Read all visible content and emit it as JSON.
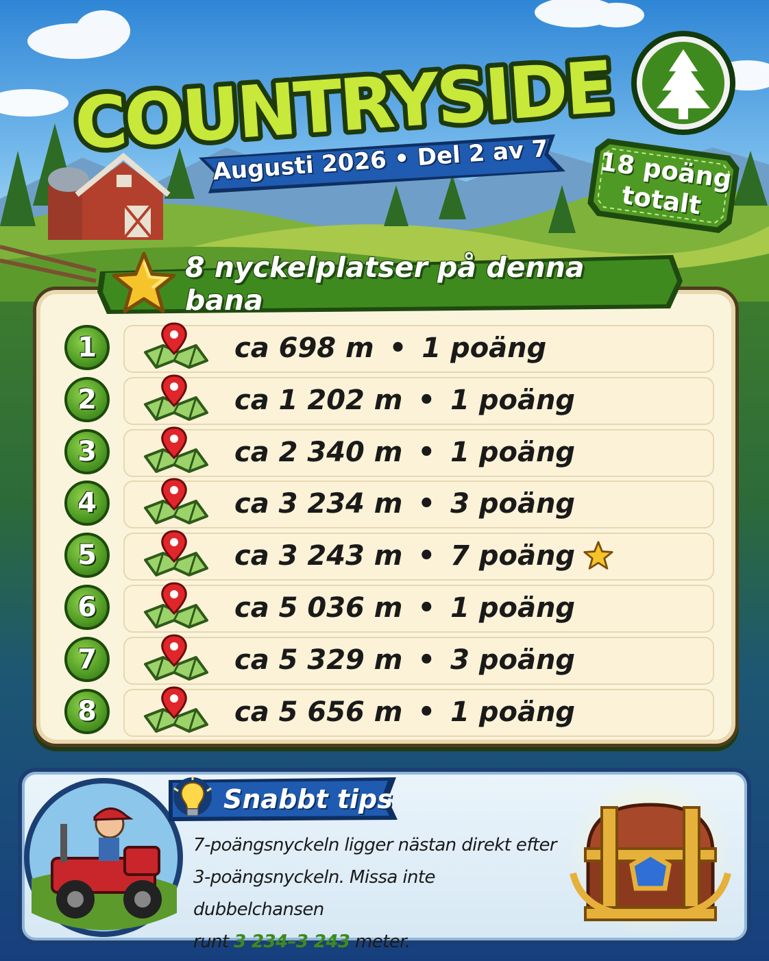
{
  "header": {
    "title": "COUNTRYSIDE",
    "subtitle": "Augusti 2026 • Del 2 av 7",
    "total_line1": "18 poäng",
    "total_line2": "totalt",
    "badge_icon": "pine-tree-icon"
  },
  "keys_panel": {
    "banner_icon": "star-icon",
    "banner_title": "8 nyckelplatser på denna bana",
    "rows": [
      {
        "number": "1",
        "distance": "ca 698 m",
        "separator": "•",
        "points": "1 poäng",
        "icon": "map-pin-icon",
        "highlight": false
      },
      {
        "number": "2",
        "distance": "ca 1 202 m",
        "separator": "•",
        "points": "1 poäng",
        "icon": "map-pin-icon",
        "highlight": false
      },
      {
        "number": "3",
        "distance": "ca 2 340 m",
        "separator": "•",
        "points": "1 poäng",
        "icon": "map-pin-icon",
        "highlight": false
      },
      {
        "number": "4",
        "distance": "ca 3 234 m",
        "separator": "•",
        "points": "3 poäng",
        "icon": "map-pin-icon",
        "highlight": false
      },
      {
        "number": "5",
        "distance": "ca 3 243 m",
        "separator": "•",
        "points": "7 poäng",
        "icon": "map-pin-icon",
        "highlight": true
      },
      {
        "number": "6",
        "distance": "ca 5 036 m",
        "separator": "•",
        "points": "1 poäng",
        "icon": "map-pin-icon",
        "highlight": false
      },
      {
        "number": "7",
        "distance": "ca 5 329 m",
        "separator": "•",
        "points": "3 poäng",
        "icon": "map-pin-icon",
        "highlight": false
      },
      {
        "number": "8",
        "distance": "ca 5 656 m",
        "separator": "•",
        "points": "1 poäng",
        "icon": "map-pin-icon",
        "highlight": false
      }
    ]
  },
  "tip": {
    "icon": "lightbulb-icon",
    "title": "Snabbt tips",
    "line1": "7-poängsnyckeln ligger nästan direkt efter",
    "line2": "3-poängsnyckeln. Missa inte dubbelchansen",
    "line3_prefix": "runt ",
    "line3_highlight": "3 234–3 243",
    "line3_suffix": " meter.",
    "character": "driver-in-jeep",
    "reward": "treasure-chest-icon"
  },
  "colors": {
    "title_green": "#c8e83a",
    "banner_green": "#3f8a1e",
    "ribbon_blue": "#1f4f99",
    "highlight_green": "#3d8a1c",
    "star_gold": "#f6c42a"
  }
}
